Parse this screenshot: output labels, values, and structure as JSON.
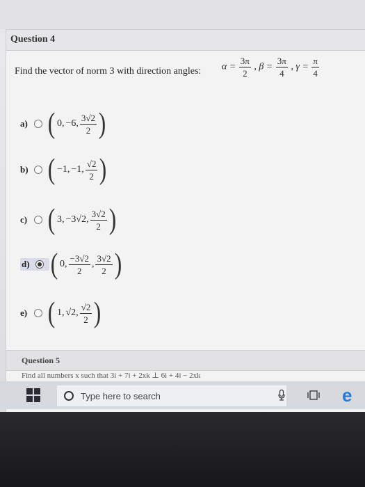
{
  "question4": {
    "title": "Question 4",
    "prompt": "Find the vector of norm 3 with direction angles:",
    "alpha_label": "α =",
    "alpha_num": "3π",
    "alpha_den": "2",
    "beta_label": ", β =",
    "beta_num": "3π",
    "beta_den": "4",
    "gamma_label": ", γ =",
    "gamma_num": "π",
    "gamma_den": "4"
  },
  "options": [
    {
      "letter": "a)",
      "c1": "0,",
      "c2": "−6,",
      "num": "3√2",
      "den": "2",
      "selected": false
    },
    {
      "letter": "b)",
      "c1": "−1,",
      "c2": "−1,",
      "num": "√2",
      "den": "2",
      "selected": false
    },
    {
      "letter": "c)",
      "c1": "3,",
      "c2": "−3√2,",
      "num": "3√2",
      "den": "2",
      "selected": false
    },
    {
      "letter": "d)",
      "c1": "0,",
      "num2": "−3√2",
      "den2": "2",
      "sep": ",",
      "num": "3√2",
      "den": "2",
      "selected": true
    },
    {
      "letter": "e)",
      "c1": "1,",
      "c2": "√2,",
      "num": "√2",
      "den": "2",
      "selected": false
    }
  ],
  "question5": {
    "title": "Question 5",
    "text": "Find all numbers x such that 3i + 7j + 2xk ⊥ 6i + 4j − 2xk"
  },
  "taskbar": {
    "search_placeholder": "Type here to search",
    "start_icon": "windows-logo-icon",
    "search_icon": "cortana-circle-icon",
    "mic_icon": "microphone-icon",
    "taskview_icon": "task-view-icon",
    "edge_icon": "edge-browser-icon",
    "edge_glyph": "e"
  }
}
